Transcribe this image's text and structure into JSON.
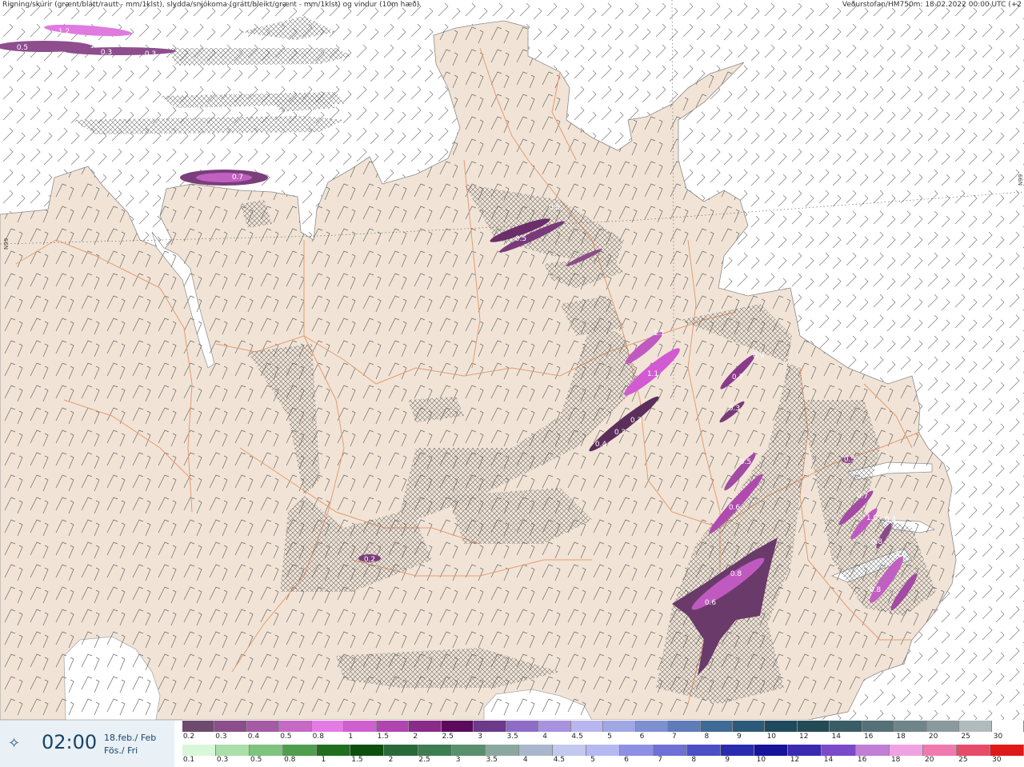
{
  "header": {
    "left_title": "Rigning/skúrir (grænt/blátt/rautt - mm/1klst), slydda/snjókoma (grátt/bleikt/grænt - mm/1klst) og vindur (10m hæð)",
    "right_title": "Veðurstofan/HM750m: 18.02.2022 00:00 UTC (+2"
  },
  "grid_labels": {
    "left": "N99",
    "right": "N99"
  },
  "time_panel": {
    "icon": "wind-compass-icon",
    "time": "02:00",
    "date_line": "18.feb./ Feb",
    "day_line": "Fös./ Fri"
  },
  "legend_snow": {
    "ticks": [
      "0.2",
      "0.3",
      "0.4",
      "0.5",
      "0.8",
      "1",
      "1.5",
      "2",
      "2.5",
      "3",
      "3.5",
      "4",
      "4.5",
      "5",
      "6",
      "7",
      "8",
      "9",
      "10",
      "12",
      "14",
      "16",
      "18",
      "20",
      "25",
      "30"
    ],
    "colors": [
      "#6e4a6e",
      "#8a4e8a",
      "#a55aa5",
      "#c46ac4",
      "#e47be4",
      "#d05fd0",
      "#b044b0",
      "#8a2a8a",
      "#5c0a5c",
      "#6b3a8a",
      "#8e6cc6",
      "#a792e0",
      "#b9b5ee",
      "#9fa8e4",
      "#7d90d0",
      "#5f7bb8",
      "#3f6a96",
      "#2d5a78",
      "#1f4a5e",
      "#244a55",
      "#3a5c66",
      "#557076",
      "#6f8589",
      "#8a9a9c",
      "#b0bbbd",
      "#ffffff"
    ]
  },
  "legend_rain": {
    "ticks": [
      "0.1",
      "0.3",
      "0.5",
      "0.8",
      "1",
      "1.5",
      "2",
      "2.5",
      "3",
      "3.5",
      "4",
      "4.5",
      "5",
      "6",
      "7",
      "8",
      "9",
      "10",
      "12",
      "14",
      "16",
      "18",
      "20",
      "25",
      "30"
    ],
    "colors": [
      "#d9f7d9",
      "#aadfaa",
      "#7ec47e",
      "#4e9e4e",
      "#1f6f1f",
      "#0d4f0d",
      "#2a6a3a",
      "#3e7c52",
      "#5a8f6e",
      "#8aa8a0",
      "#a9b7cc",
      "#c3c8ee",
      "#b6b8f2",
      "#8e90e4",
      "#6e70d6",
      "#4c4ec6",
      "#2a2cb0",
      "#16149a",
      "#3a2ab0",
      "#7a4ac8",
      "#c07ed6",
      "#f0a2e0",
      "#f07ab0",
      "#e84a6a",
      "#e01818"
    ]
  },
  "precip_labels": [
    {
      "t": "1.2"
    },
    {
      "t": "0.5"
    },
    {
      "t": "0.3"
    },
    {
      "t": "0.3"
    },
    {
      "t": "0.7"
    },
    {
      "t": "0.5"
    },
    {
      "t": "0.5"
    },
    {
      "t": "1.1"
    },
    {
      "t": "1.1"
    },
    {
      "t": "0.3"
    },
    {
      "t": "0.3"
    },
    {
      "t": "0.4"
    },
    {
      "t": "0.6"
    },
    {
      "t": "0.7"
    },
    {
      "t": "0.3"
    },
    {
      "t": "0.5"
    },
    {
      "t": "0.6"
    },
    {
      "t": "0.8"
    },
    {
      "t": "0.6"
    },
    {
      "t": "0.2"
    },
    {
      "t": "0.7"
    },
    {
      "t": "1.0"
    },
    {
      "t": "0.4"
    },
    {
      "t": "0.8"
    },
    {
      "t": "1.6"
    },
    {
      "t": "0.8"
    },
    {
      "t": "0.5"
    }
  ]
}
